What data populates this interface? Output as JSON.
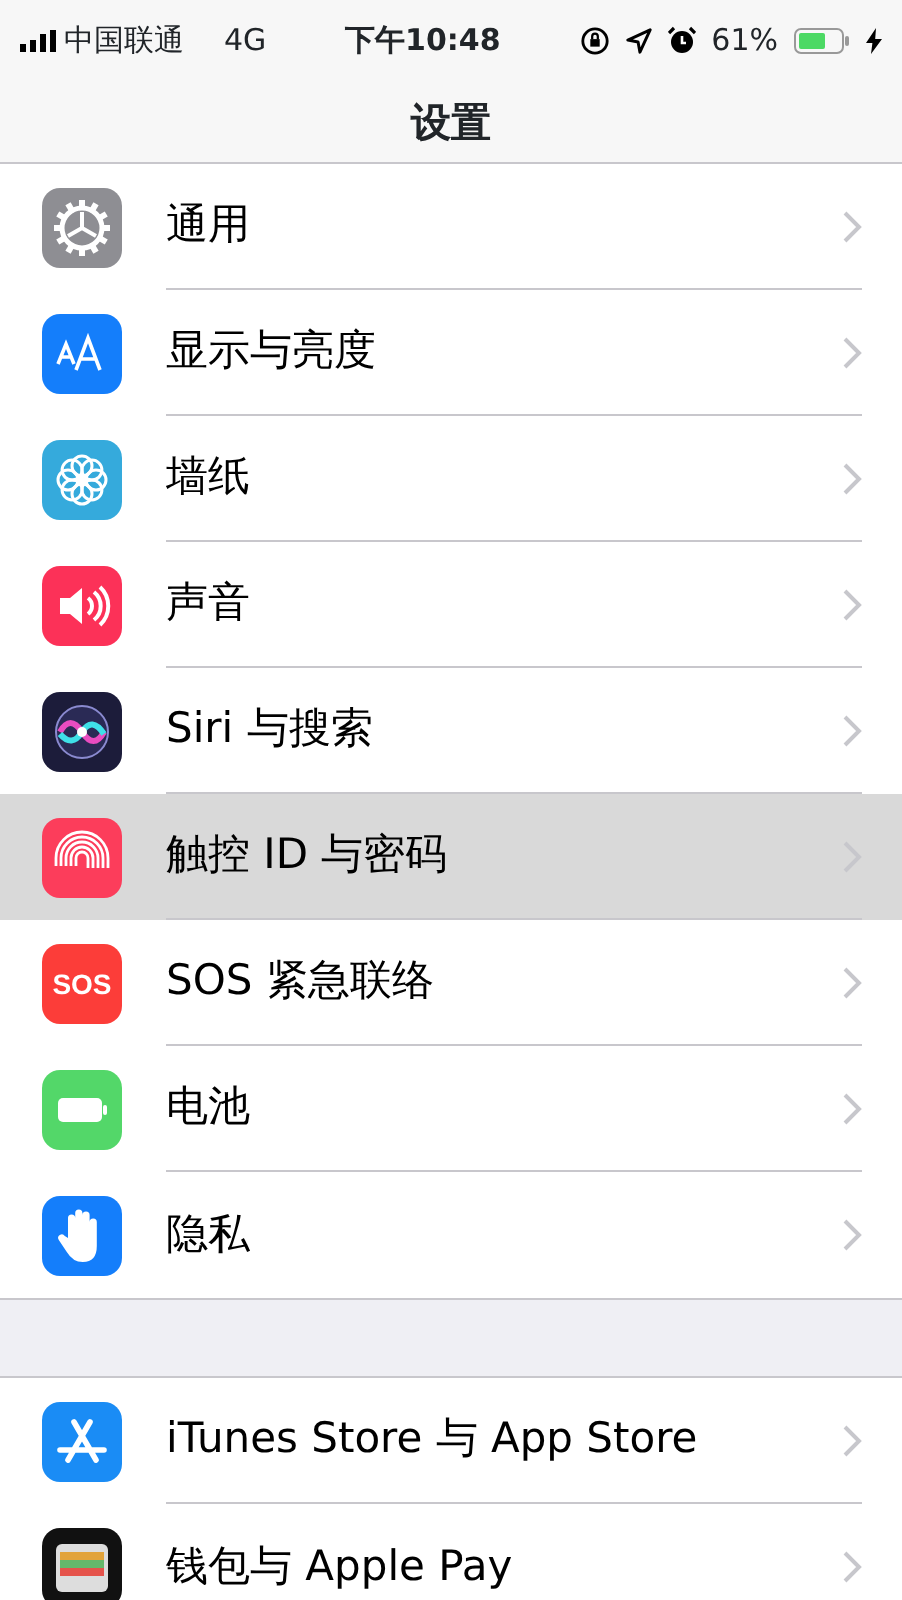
{
  "status_bar": {
    "carrier": "中国联通",
    "network": "4G",
    "time": "下午10:48",
    "battery": "61%"
  },
  "title": "设置",
  "groups": [
    {
      "rows": [
        {
          "kind": "gear",
          "color": "#8e8e93",
          "label": "通用",
          "selected": false
        },
        {
          "kind": "textsize",
          "color": "#147efb",
          "label": "显示与亮度",
          "selected": false
        },
        {
          "kind": "flower",
          "color": "#35aadc",
          "label": "墙纸",
          "selected": false
        },
        {
          "kind": "speaker",
          "color": "#fc3158",
          "label": "声音",
          "selected": false
        },
        {
          "kind": "siri",
          "color": "#1c1c3a",
          "label": "Siri 与搜索",
          "selected": false
        },
        {
          "kind": "fingerprint",
          "color": "#fc3d5b",
          "label": "触控 ID 与密码",
          "selected": true
        },
        {
          "kind": "sos",
          "color": "#fc3d39",
          "icon_text": "SOS",
          "label": "SOS 紧急联络",
          "selected": false
        },
        {
          "kind": "battery",
          "color": "#53d769",
          "label": "电池",
          "selected": false
        },
        {
          "kind": "hand",
          "color": "#147efb",
          "label": "隐私",
          "selected": false
        }
      ]
    },
    {
      "rows": [
        {
          "kind": "appstore",
          "color": "#1a8cf5",
          "label": "iTunes Store 与 App Store",
          "selected": false
        },
        {
          "kind": "wallet",
          "color": "#111111",
          "label": "钱包与 Apple Pay",
          "selected": false
        }
      ]
    }
  ]
}
